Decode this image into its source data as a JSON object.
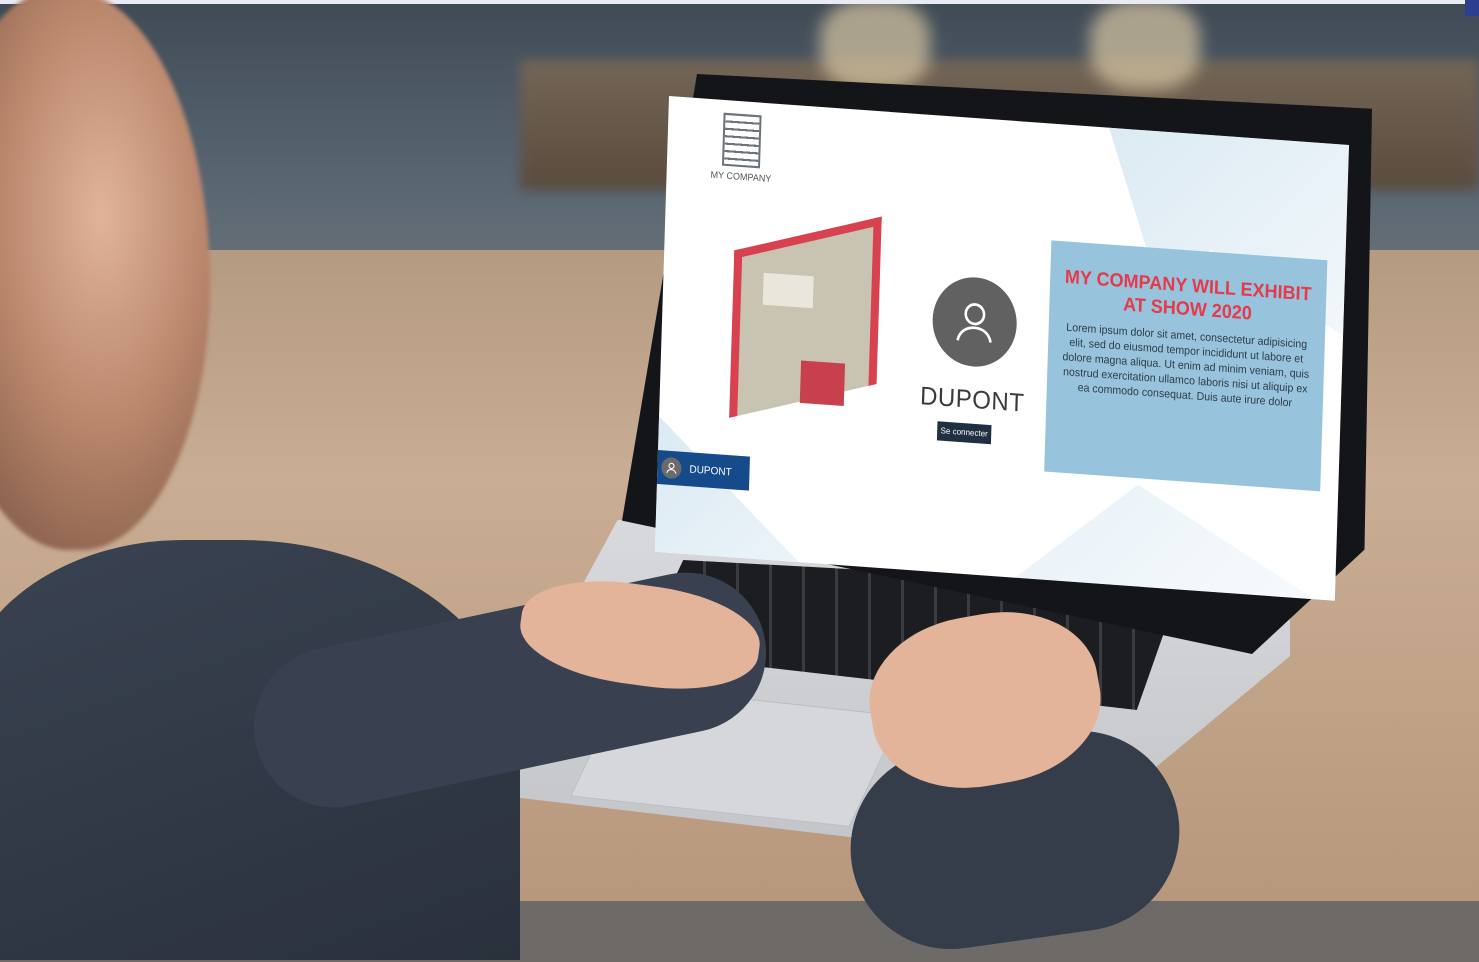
{
  "screen": {
    "logo": {
      "company": "MY COMPANY",
      "icon": "building-icon"
    },
    "profile": {
      "name": "DUPONT",
      "icon": "user-avatar-icon"
    },
    "login_button": {
      "label": "Se connecter"
    },
    "promo": {
      "title": "MY COMPANY WILL EXHIBIT AT SHOW 2020",
      "body": "Lorem ipsum dolor sit amet, consectetur adipisicing elit, sed do eiusmod tempor incididunt ut labore et dolore magna aliqua. Ut enim ad minim veniam, quis nostrud exercitation ullamco laboris nisi ut aliquip ex ea commodo consequat. Duis aute irure dolor"
    },
    "user_chip": {
      "name": "DUPONT"
    }
  },
  "colors": {
    "promo_bg": "#97c4dc",
    "promo_title": "#e43a4b",
    "chip_bg": "#154b8a",
    "button_bg": "#1f3042",
    "avatar_bg": "#616161"
  }
}
